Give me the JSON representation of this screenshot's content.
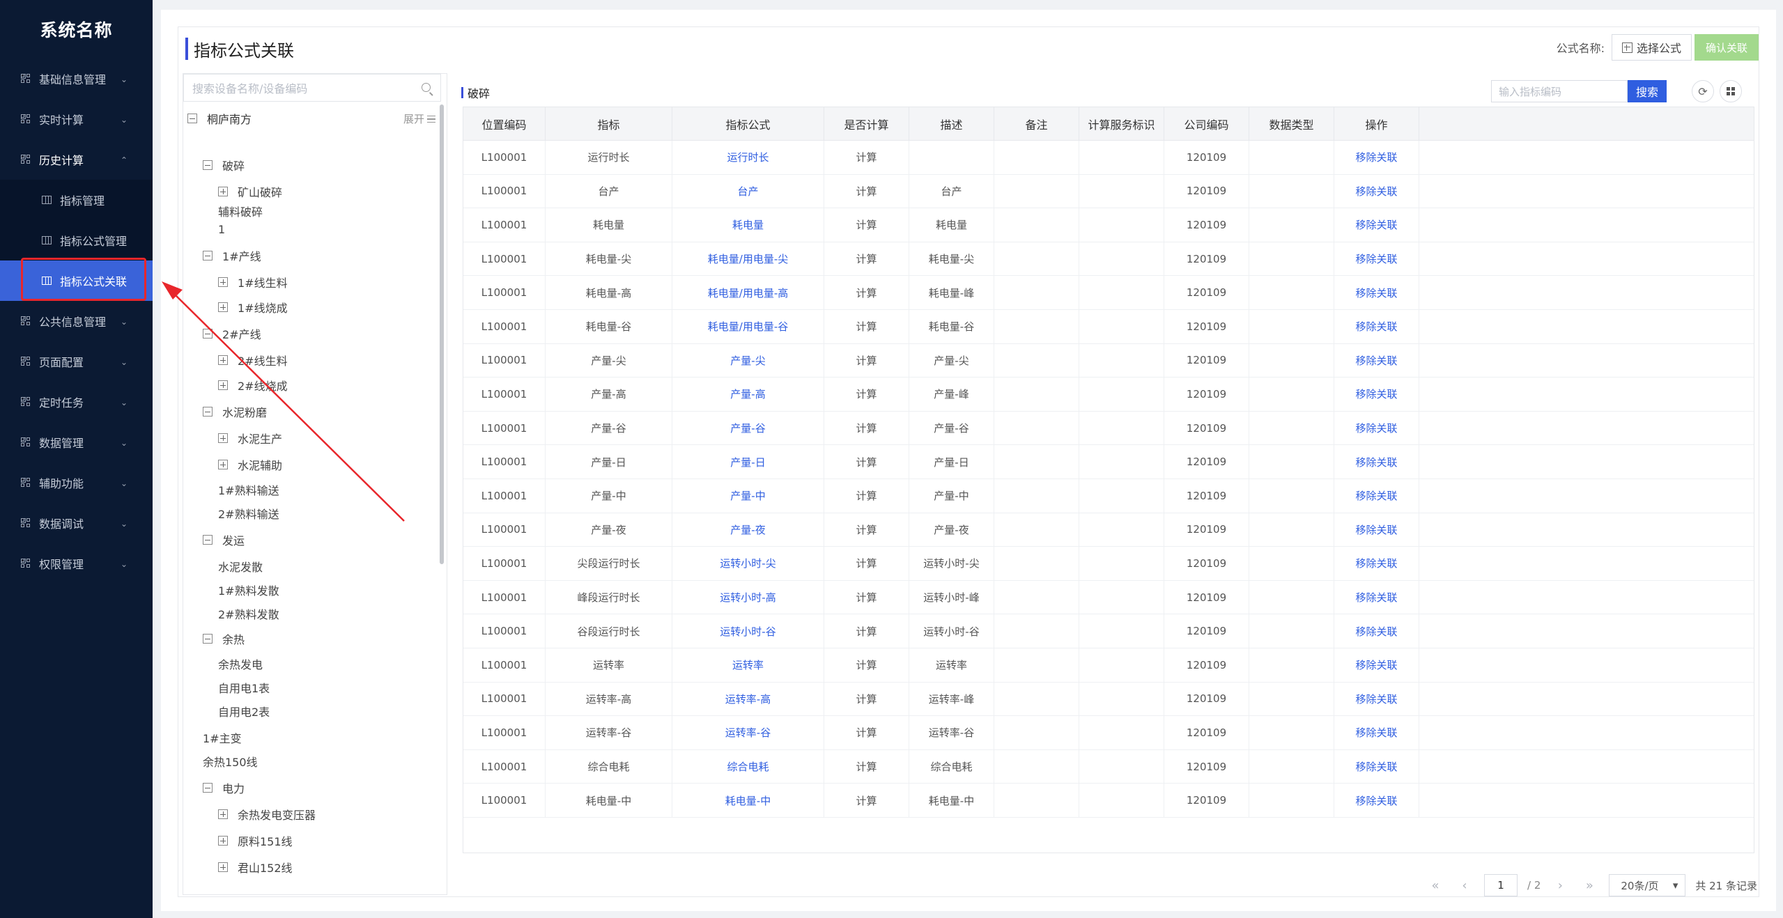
{
  "app": {
    "title": "系统名称"
  },
  "sidebar": {
    "items": [
      {
        "label": "基础信息管理",
        "open": false
      },
      {
        "label": "实时计算",
        "open": false
      },
      {
        "label": "历史计算",
        "open": true,
        "children": [
          {
            "label": "指标管理",
            "active": false
          },
          {
            "label": "指标公式管理",
            "active": false
          },
          {
            "label": "指标公式关联",
            "active": true
          }
        ]
      },
      {
        "label": "公共信息管理",
        "open": false
      },
      {
        "label": "页面配置",
        "open": false
      },
      {
        "label": "定时任务",
        "open": false
      },
      {
        "label": "数据管理",
        "open": false
      },
      {
        "label": "辅助功能",
        "open": false
      },
      {
        "label": "数据调试",
        "open": false
      },
      {
        "label": "权限管理",
        "open": false
      }
    ]
  },
  "page": {
    "title": "指标公式关联",
    "formula_label": "公式名称:",
    "select_formula": "选择公式",
    "confirm": "确认关联"
  },
  "tree": {
    "search_placeholder": "搜索设备名称/设备编码",
    "root": "桐庐南方",
    "expand_all": "展开",
    "nodes": [
      {
        "label": "破碎",
        "level": 1,
        "toggle": "minus"
      },
      {
        "label": "矿山破碎",
        "level": 2,
        "toggle": "plus"
      },
      {
        "label": "辅料破碎",
        "level": 2,
        "toggle": "none"
      },
      {
        "label": "1",
        "level": 2,
        "toggle": "none"
      },
      {
        "label": "1#产线",
        "level": 1,
        "toggle": "minus"
      },
      {
        "label": "1#线生料",
        "level": 2,
        "toggle": "plus"
      },
      {
        "label": "1#线烧成",
        "level": 2,
        "toggle": "plus"
      },
      {
        "label": "2#产线",
        "level": 1,
        "toggle": "minus"
      },
      {
        "label": "2#线生料",
        "level": 2,
        "toggle": "plus"
      },
      {
        "label": "2#线烧成",
        "level": 2,
        "toggle": "plus"
      },
      {
        "label": "水泥粉磨",
        "level": 1,
        "toggle": "minus"
      },
      {
        "label": "水泥生产",
        "level": 2,
        "toggle": "plus"
      },
      {
        "label": "水泥辅助",
        "level": 2,
        "toggle": "plus"
      },
      {
        "label": "1#熟料输送",
        "level": 2,
        "toggle": "none"
      },
      {
        "label": "2#熟料输送",
        "level": 2,
        "toggle": "none"
      },
      {
        "label": "发运",
        "level": 1,
        "toggle": "minus"
      },
      {
        "label": "水泥发散",
        "level": 2,
        "toggle": "none"
      },
      {
        "label": "1#熟料发散",
        "level": 2,
        "toggle": "none"
      },
      {
        "label": "2#熟料发散",
        "level": 2,
        "toggle": "none"
      },
      {
        "label": "余热",
        "level": 1,
        "toggle": "minus"
      },
      {
        "label": "余热发电",
        "level": 2,
        "toggle": "none"
      },
      {
        "label": "自用电1表",
        "level": 2,
        "toggle": "none"
      },
      {
        "label": "自用电2表",
        "level": 2,
        "toggle": "none"
      },
      {
        "label": "1#主变",
        "level": 1,
        "toggle": "none"
      },
      {
        "label": "余热150线",
        "level": 1,
        "toggle": "none"
      },
      {
        "label": "电力",
        "level": 1,
        "toggle": "minus"
      },
      {
        "label": "余热发电变压器",
        "level": 2,
        "toggle": "plus"
      },
      {
        "label": "原料151线",
        "level": 2,
        "toggle": "plus"
      },
      {
        "label": "君山152线",
        "level": 2,
        "toggle": "plus"
      }
    ]
  },
  "content": {
    "section_title": "破碎",
    "search_placeholder": "输入指标编码",
    "search_button": "搜索",
    "refresh_icon": "refresh-icon",
    "layout_icon": "layout-grid-icon"
  },
  "table": {
    "columns": [
      "位置编码",
      "指标",
      "指标公式",
      "是否计算",
      "描述",
      "备注",
      "计算服务标识",
      "公司编码",
      "数据类型",
      "操作"
    ],
    "rows": [
      [
        "L100001",
        "运行时长",
        "运行时长",
        "计算",
        "",
        "",
        "",
        "120109",
        "",
        "移除关联"
      ],
      [
        "L100001",
        "台产",
        "台产",
        "计算",
        "台产",
        "",
        "",
        "120109",
        "",
        "移除关联"
      ],
      [
        "L100001",
        "耗电量",
        "耗电量",
        "计算",
        "耗电量",
        "",
        "",
        "120109",
        "",
        "移除关联"
      ],
      [
        "L100001",
        "耗电量-尖",
        "耗电量/用电量-尖",
        "计算",
        "耗电量-尖",
        "",
        "",
        "120109",
        "",
        "移除关联"
      ],
      [
        "L100001",
        "耗电量-高",
        "耗电量/用电量-高",
        "计算",
        "耗电量-峰",
        "",
        "",
        "120109",
        "",
        "移除关联"
      ],
      [
        "L100001",
        "耗电量-谷",
        "耗电量/用电量-谷",
        "计算",
        "耗电量-谷",
        "",
        "",
        "120109",
        "",
        "移除关联"
      ],
      [
        "L100001",
        "产量-尖",
        "产量-尖",
        "计算",
        "产量-尖",
        "",
        "",
        "120109",
        "",
        "移除关联"
      ],
      [
        "L100001",
        "产量-高",
        "产量-高",
        "计算",
        "产量-峰",
        "",
        "",
        "120109",
        "",
        "移除关联"
      ],
      [
        "L100001",
        "产量-谷",
        "产量-谷",
        "计算",
        "产量-谷",
        "",
        "",
        "120109",
        "",
        "移除关联"
      ],
      [
        "L100001",
        "产量-日",
        "产量-日",
        "计算",
        "产量-日",
        "",
        "",
        "120109",
        "",
        "移除关联"
      ],
      [
        "L100001",
        "产量-中",
        "产量-中",
        "计算",
        "产量-中",
        "",
        "",
        "120109",
        "",
        "移除关联"
      ],
      [
        "L100001",
        "产量-夜",
        "产量-夜",
        "计算",
        "产量-夜",
        "",
        "",
        "120109",
        "",
        "移除关联"
      ],
      [
        "L100001",
        "尖段运行时长",
        "运转小时-尖",
        "计算",
        "运转小时-尖",
        "",
        "",
        "120109",
        "",
        "移除关联"
      ],
      [
        "L100001",
        "峰段运行时长",
        "运转小时-高",
        "计算",
        "运转小时-峰",
        "",
        "",
        "120109",
        "",
        "移除关联"
      ],
      [
        "L100001",
        "谷段运行时长",
        "运转小时-谷",
        "计算",
        "运转小时-谷",
        "",
        "",
        "120109",
        "",
        "移除关联"
      ],
      [
        "L100001",
        "运转率",
        "运转率",
        "计算",
        "运转率",
        "",
        "",
        "120109",
        "",
        "移除关联"
      ],
      [
        "L100001",
        "运转率-高",
        "运转率-高",
        "计算",
        "运转率-峰",
        "",
        "",
        "120109",
        "",
        "移除关联"
      ],
      [
        "L100001",
        "运转率-谷",
        "运转率-谷",
        "计算",
        "运转率-谷",
        "",
        "",
        "120109",
        "",
        "移除关联"
      ],
      [
        "L100001",
        "综合电耗",
        "综合电耗",
        "计算",
        "综合电耗",
        "",
        "",
        "120109",
        "",
        "移除关联"
      ],
      [
        "L100001",
        "耗电量-中",
        "耗电量-中",
        "计算",
        "耗电量-中",
        "",
        "",
        "120109",
        "",
        "移除关联"
      ]
    ]
  },
  "pagination": {
    "current_page": "1",
    "total_pages": "/ 2",
    "page_size": "20条/页",
    "total": "共 21 条记录"
  },
  "colors": {
    "accent": "#2f5ee0",
    "sidebar_bg": "#0b1a33",
    "active_item": "#3a63d9",
    "annotation": "#e8262b"
  }
}
